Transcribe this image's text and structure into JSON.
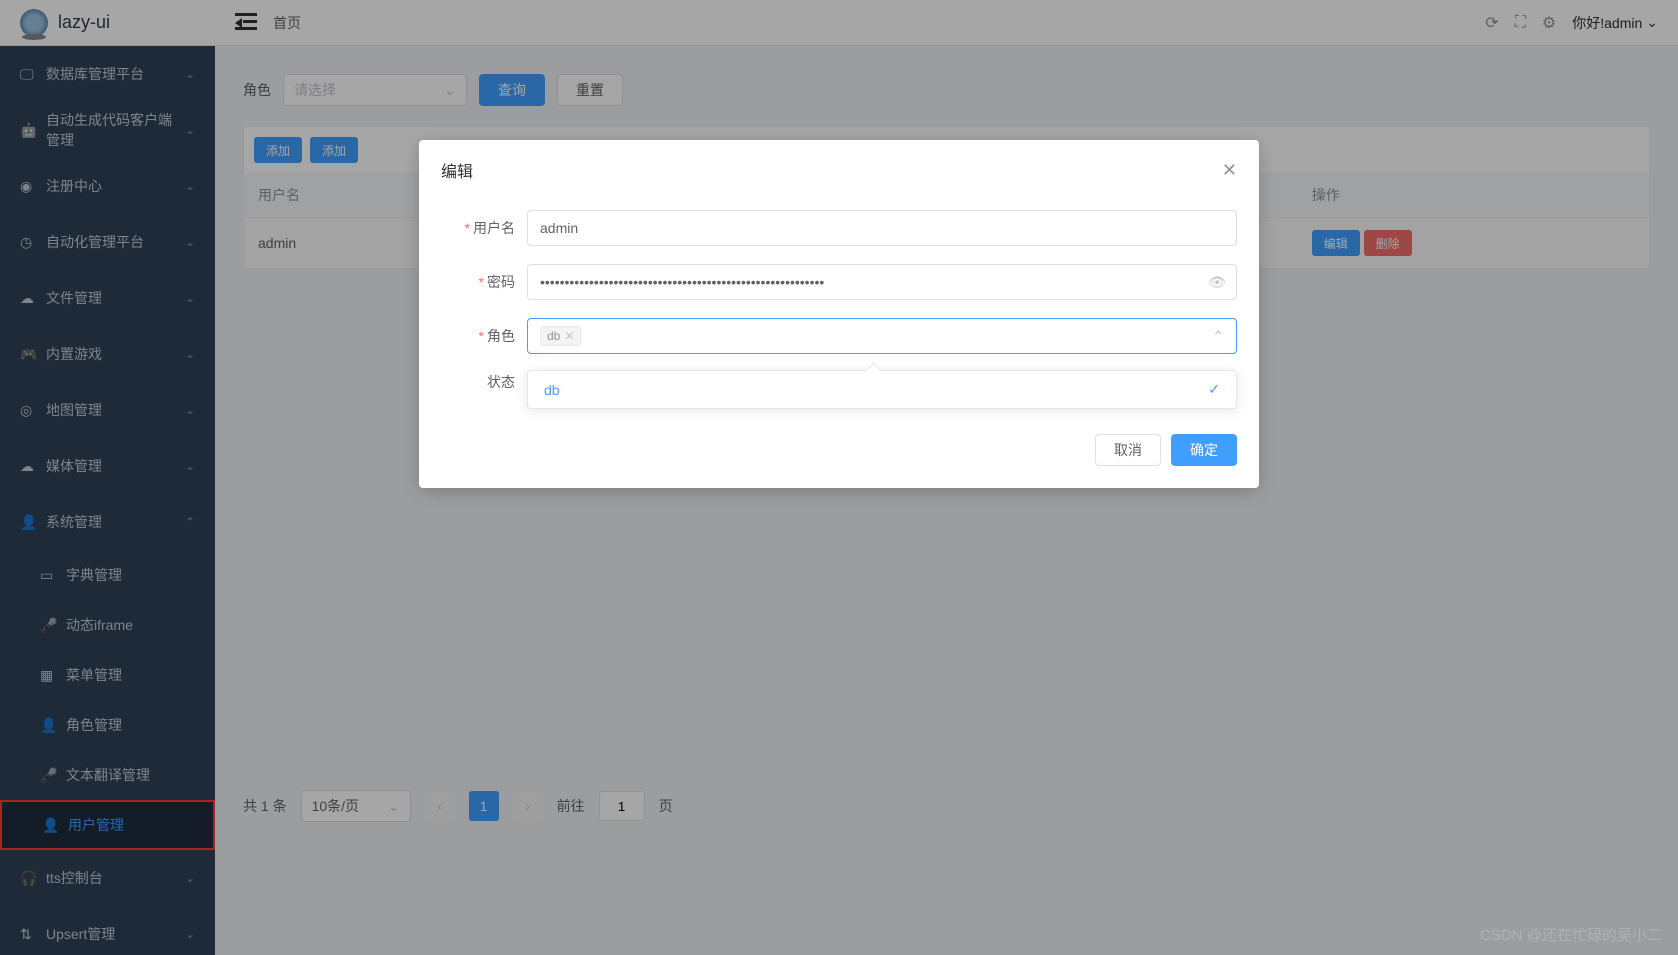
{
  "app": {
    "name": "lazy-ui"
  },
  "header": {
    "breadcrumb": "首页",
    "greeting": "你好!admin"
  },
  "sidebar": {
    "items": [
      {
        "label": "数据库管理平台",
        "expandable": true
      },
      {
        "label": "自动生成代码客户端管理",
        "expandable": true
      },
      {
        "label": "注册中心",
        "expandable": true
      },
      {
        "label": "自动化管理平台",
        "expandable": true
      },
      {
        "label": "文件管理",
        "expandable": true
      },
      {
        "label": "内置游戏",
        "expandable": true
      },
      {
        "label": "地图管理",
        "expandable": true
      },
      {
        "label": "媒体管理",
        "expandable": true
      },
      {
        "label": "系统管理",
        "expandable": true,
        "expanded": true,
        "children": [
          {
            "label": "字典管理"
          },
          {
            "label": "动态iframe"
          },
          {
            "label": "菜单管理"
          },
          {
            "label": "角色管理"
          },
          {
            "label": "文本翻译管理"
          },
          {
            "label": "用户管理",
            "active": true
          }
        ]
      },
      {
        "label": "tts控制台",
        "expandable": true
      },
      {
        "label": "Upsert管理",
        "expandable": true
      }
    ]
  },
  "filter": {
    "label": "角色",
    "placeholder": "请选择",
    "query_btn": "查询",
    "reset_btn": "重置"
  },
  "toolbar": {
    "add_btn": "添加"
  },
  "table": {
    "headers": {
      "username": "用户名",
      "operation": "操作"
    },
    "rows": [
      {
        "username": "admin"
      }
    ],
    "row_actions": {
      "edit": "编辑",
      "delete": "删除"
    }
  },
  "pagination": {
    "total_text": "共 1 条",
    "page_size": "10条/页",
    "current": "1",
    "goto_label": "前往",
    "goto_value": "1",
    "page_suffix": "页"
  },
  "modal": {
    "title": "编辑",
    "fields": {
      "username": {
        "label": "用户名",
        "value": "admin",
        "required": true
      },
      "password": {
        "label": "密码",
        "value": "••••••••••••••••••••••••••••••••••••••••••••••••••••••••••",
        "required": true
      },
      "role": {
        "label": "角色",
        "required": true,
        "tags": [
          "db"
        ],
        "options": [
          "db"
        ],
        "selected": "db"
      },
      "status": {
        "label": "状态",
        "required": false
      }
    },
    "footer": {
      "cancel": "取消",
      "confirm": "确定"
    }
  },
  "watermark": "CSDN @还在忙碌的吴小二"
}
